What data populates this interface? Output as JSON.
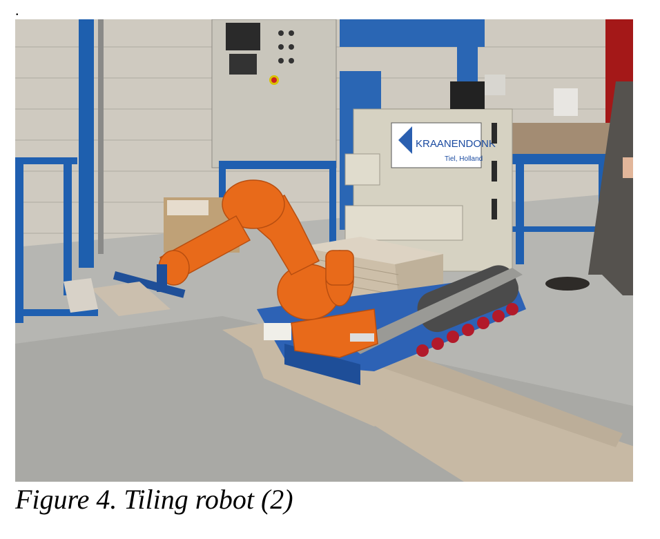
{
  "page": {
    "leading_mark": ".",
    "caption": "Figure 4. Tiling robot (2)"
  },
  "photo": {
    "subject": "orange industrial robot arm on a tracked carrier laying tiles",
    "sign_text": "KRAANENDONK",
    "sign_subtext": "Tiel, Holland"
  }
}
